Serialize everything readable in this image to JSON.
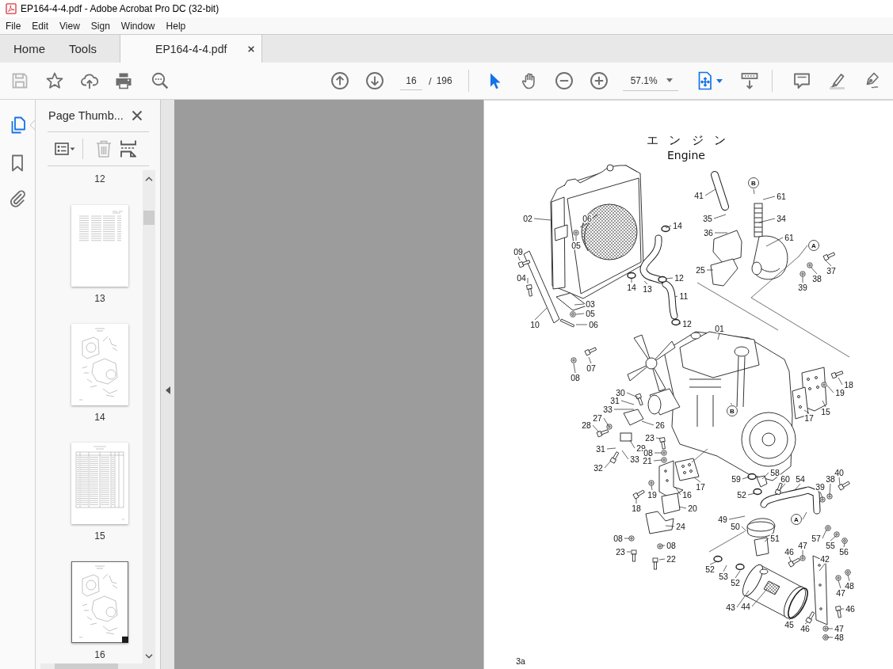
{
  "window": {
    "title": "EP164-4-4.pdf - Adobe Acrobat Pro DC (32-bit)"
  },
  "menu": [
    "File",
    "Edit",
    "View",
    "Sign",
    "Window",
    "Help"
  ],
  "tabs": [
    {
      "label": "Home",
      "kind": "nav",
      "selected": false
    },
    {
      "label": "Tools",
      "kind": "nav",
      "selected": false
    },
    {
      "label": "EP164-4-4.pdf",
      "kind": "document",
      "selected": true
    }
  ],
  "toolbar": {
    "save_disabled": true,
    "page_number": "16",
    "page_separator": "/",
    "page_count": "196",
    "pointer_tools": [
      {
        "selected": true
      },
      {
        "selected": false
      }
    ],
    "zoom": "57.1%"
  },
  "nav_rail": [
    {
      "selected": true
    },
    {
      "selected": false
    },
    {
      "selected": false
    }
  ],
  "thumbnail_panel": {
    "title": "Page Thumb...",
    "delete_disabled": true,
    "cut_off_label": "12",
    "thumbnails": [
      {
        "label": "13",
        "kind": "parts_list",
        "selected": false
      },
      {
        "label": "14",
        "kind": "diagram",
        "selected": false
      },
      {
        "label": "15",
        "kind": "table",
        "selected": false
      },
      {
        "label": "16",
        "kind": "diagram",
        "selected": true
      }
    ]
  },
  "page": {
    "title_ja": "エ ン ジ ン",
    "title_en": "Engine",
    "callouts": [
      {
        "text": "B",
        "kind": "circled"
      },
      {
        "text": "41",
        "kind": "number"
      },
      {
        "text": "61",
        "kind": "number"
      },
      {
        "text": "02",
        "kind": "number"
      },
      {
        "text": "06",
        "kind": "number"
      },
      {
        "text": "35",
        "kind": "number"
      },
      {
        "text": "34",
        "kind": "number"
      },
      {
        "text": "14",
        "kind": "number"
      },
      {
        "text": "36",
        "kind": "number"
      },
      {
        "text": "61",
        "kind": "number"
      },
      {
        "text": "05",
        "kind": "number"
      },
      {
        "text": "A",
        "kind": "circled"
      },
      {
        "text": "09",
        "kind": "number"
      },
      {
        "text": "25",
        "kind": "number"
      },
      {
        "text": "37",
        "kind": "number"
      },
      {
        "text": "04",
        "kind": "number"
      },
      {
        "text": "12",
        "kind": "number"
      },
      {
        "text": "38",
        "kind": "number"
      },
      {
        "text": "14",
        "kind": "number"
      },
      {
        "text": "13",
        "kind": "number"
      },
      {
        "text": "39",
        "kind": "number"
      },
      {
        "text": "11",
        "kind": "number"
      },
      {
        "text": "03",
        "kind": "number"
      },
      {
        "text": "05",
        "kind": "number"
      },
      {
        "text": "10",
        "kind": "number"
      },
      {
        "text": "06",
        "kind": "number"
      },
      {
        "text": "12",
        "kind": "number"
      },
      {
        "text": "01",
        "kind": "number"
      },
      {
        "text": "07",
        "kind": "number"
      },
      {
        "text": "08",
        "kind": "number"
      },
      {
        "text": "18",
        "kind": "number"
      },
      {
        "text": "30",
        "kind": "number"
      },
      {
        "text": "19",
        "kind": "number"
      },
      {
        "text": "31",
        "kind": "number"
      },
      {
        "text": "33",
        "kind": "number"
      },
      {
        "text": "B",
        "kind": "circled"
      },
      {
        "text": "15",
        "kind": "number"
      },
      {
        "text": "27",
        "kind": "number"
      },
      {
        "text": "17",
        "kind": "number"
      },
      {
        "text": "28",
        "kind": "number"
      },
      {
        "text": "26",
        "kind": "number"
      },
      {
        "text": "23",
        "kind": "number"
      },
      {
        "text": "31",
        "kind": "number"
      },
      {
        "text": "29",
        "kind": "number"
      },
      {
        "text": "08",
        "kind": "number"
      },
      {
        "text": "33",
        "kind": "number"
      },
      {
        "text": "21",
        "kind": "number"
      },
      {
        "text": "32",
        "kind": "number"
      },
      {
        "text": "58",
        "kind": "number"
      },
      {
        "text": "40",
        "kind": "number"
      },
      {
        "text": "59",
        "kind": "number"
      },
      {
        "text": "60",
        "kind": "number"
      },
      {
        "text": "54",
        "kind": "number"
      },
      {
        "text": "38",
        "kind": "number"
      },
      {
        "text": "17",
        "kind": "number"
      },
      {
        "text": "39",
        "kind": "number"
      },
      {
        "text": "19",
        "kind": "number"
      },
      {
        "text": "16",
        "kind": "number"
      },
      {
        "text": "52",
        "kind": "number"
      },
      {
        "text": "18",
        "kind": "number"
      },
      {
        "text": "20",
        "kind": "number"
      },
      {
        "text": "49",
        "kind": "number"
      },
      {
        "text": "A",
        "kind": "circled"
      },
      {
        "text": "24",
        "kind": "number"
      },
      {
        "text": "50",
        "kind": "number"
      },
      {
        "text": "08",
        "kind": "number"
      },
      {
        "text": "51",
        "kind": "number"
      },
      {
        "text": "57",
        "kind": "number"
      },
      {
        "text": "08",
        "kind": "number"
      },
      {
        "text": "47",
        "kind": "number"
      },
      {
        "text": "55",
        "kind": "number"
      },
      {
        "text": "23",
        "kind": "number"
      },
      {
        "text": "46",
        "kind": "number"
      },
      {
        "text": "56",
        "kind": "number"
      },
      {
        "text": "22",
        "kind": "number"
      },
      {
        "text": "42",
        "kind": "number"
      },
      {
        "text": "52",
        "kind": "number"
      },
      {
        "text": "53",
        "kind": "number"
      },
      {
        "text": "52",
        "kind": "number"
      },
      {
        "text": "48",
        "kind": "number"
      },
      {
        "text": "47",
        "kind": "number"
      },
      {
        "text": "43",
        "kind": "number"
      },
      {
        "text": "44",
        "kind": "number"
      },
      {
        "text": "46",
        "kind": "number"
      },
      {
        "text": "45",
        "kind": "number"
      },
      {
        "text": "46",
        "kind": "number"
      },
      {
        "text": "47",
        "kind": "number"
      },
      {
        "text": "48",
        "kind": "number"
      }
    ],
    "page_label": "3a"
  }
}
